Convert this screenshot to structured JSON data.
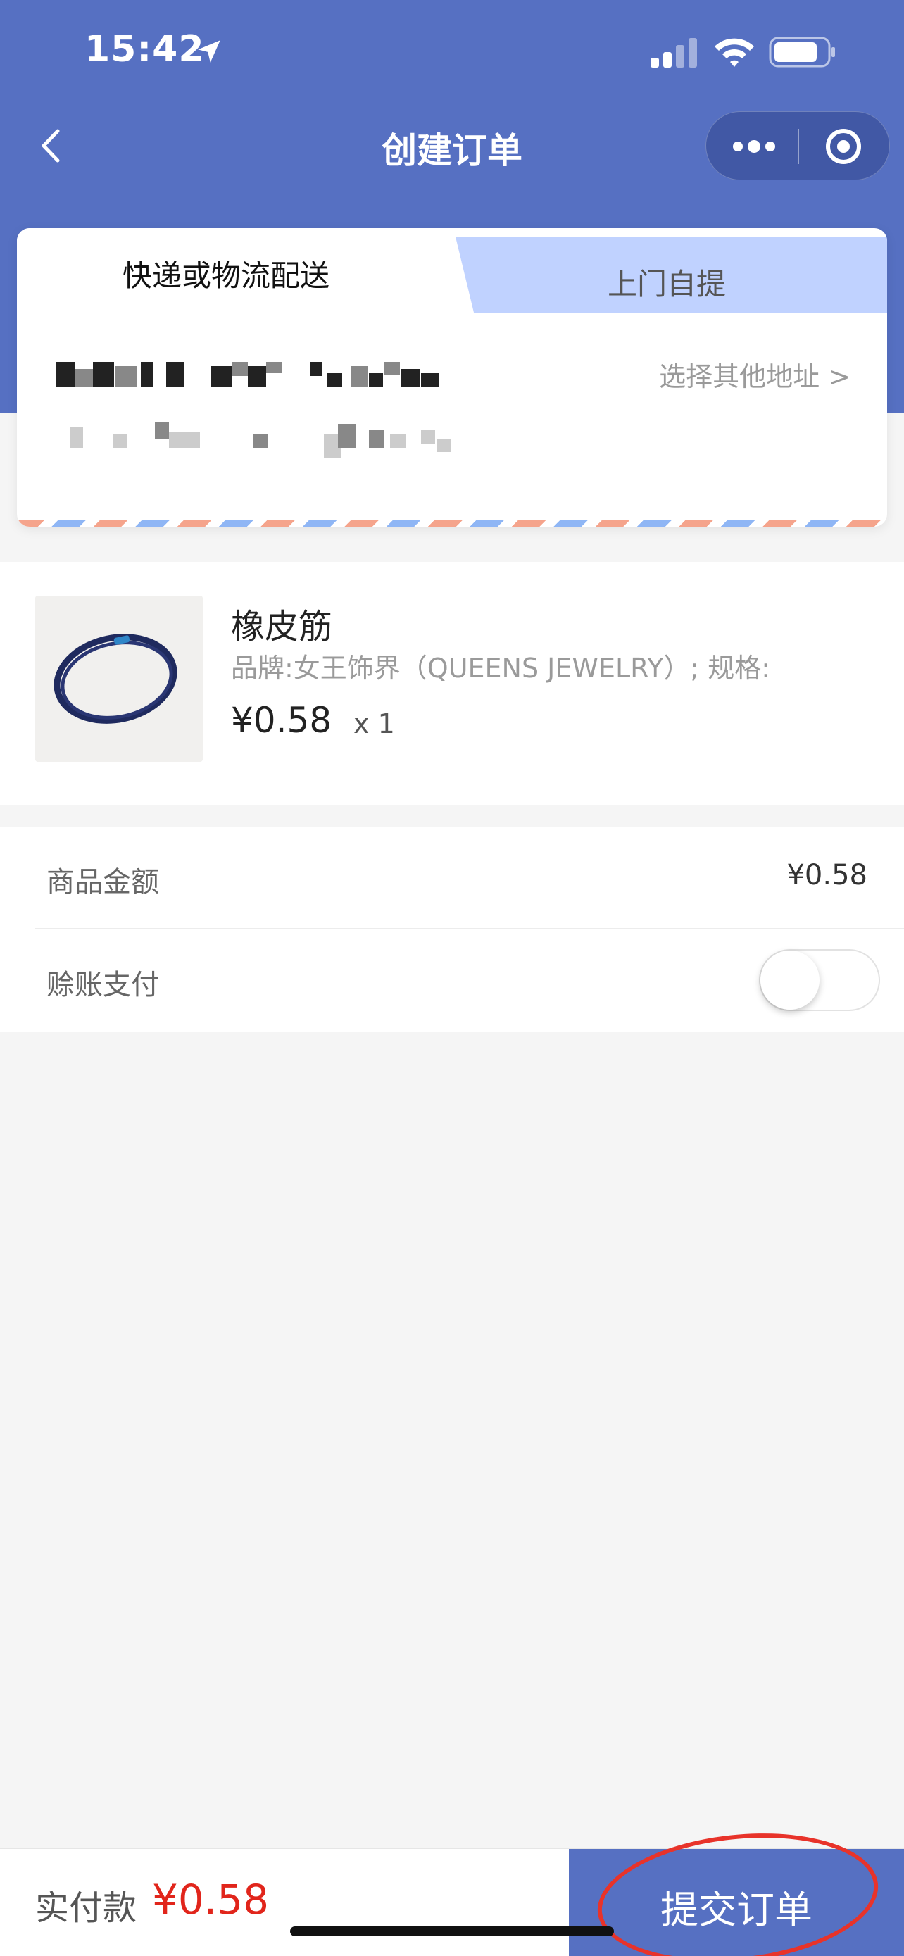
{
  "status_bar": {
    "time": "15:42"
  },
  "nav": {
    "title": "创建订单"
  },
  "delivery": {
    "tabs": [
      {
        "label": "快递或物流配送",
        "active": true
      },
      {
        "label": "上门自提",
        "active": false
      }
    ],
    "other_address_link": "选择其他地址 >"
  },
  "product": {
    "name": "橡皮筋",
    "spec": "品牌:女王饰界（QUEENS JEWELRY）; 规格:",
    "price": "¥0.58",
    "quantity": "x 1"
  },
  "amounts": {
    "goods_label": "商品金额",
    "goods_value": "¥0.58",
    "credit_label": "赊账支付",
    "credit_enabled": false
  },
  "footer": {
    "pay_label": "实付款",
    "pay_amount": "¥0.58",
    "submit_label": "提交订单"
  },
  "colors": {
    "brand": "#5670c2",
    "price_red": "#e1251b",
    "tab_inactive": "#c0d2ff"
  }
}
